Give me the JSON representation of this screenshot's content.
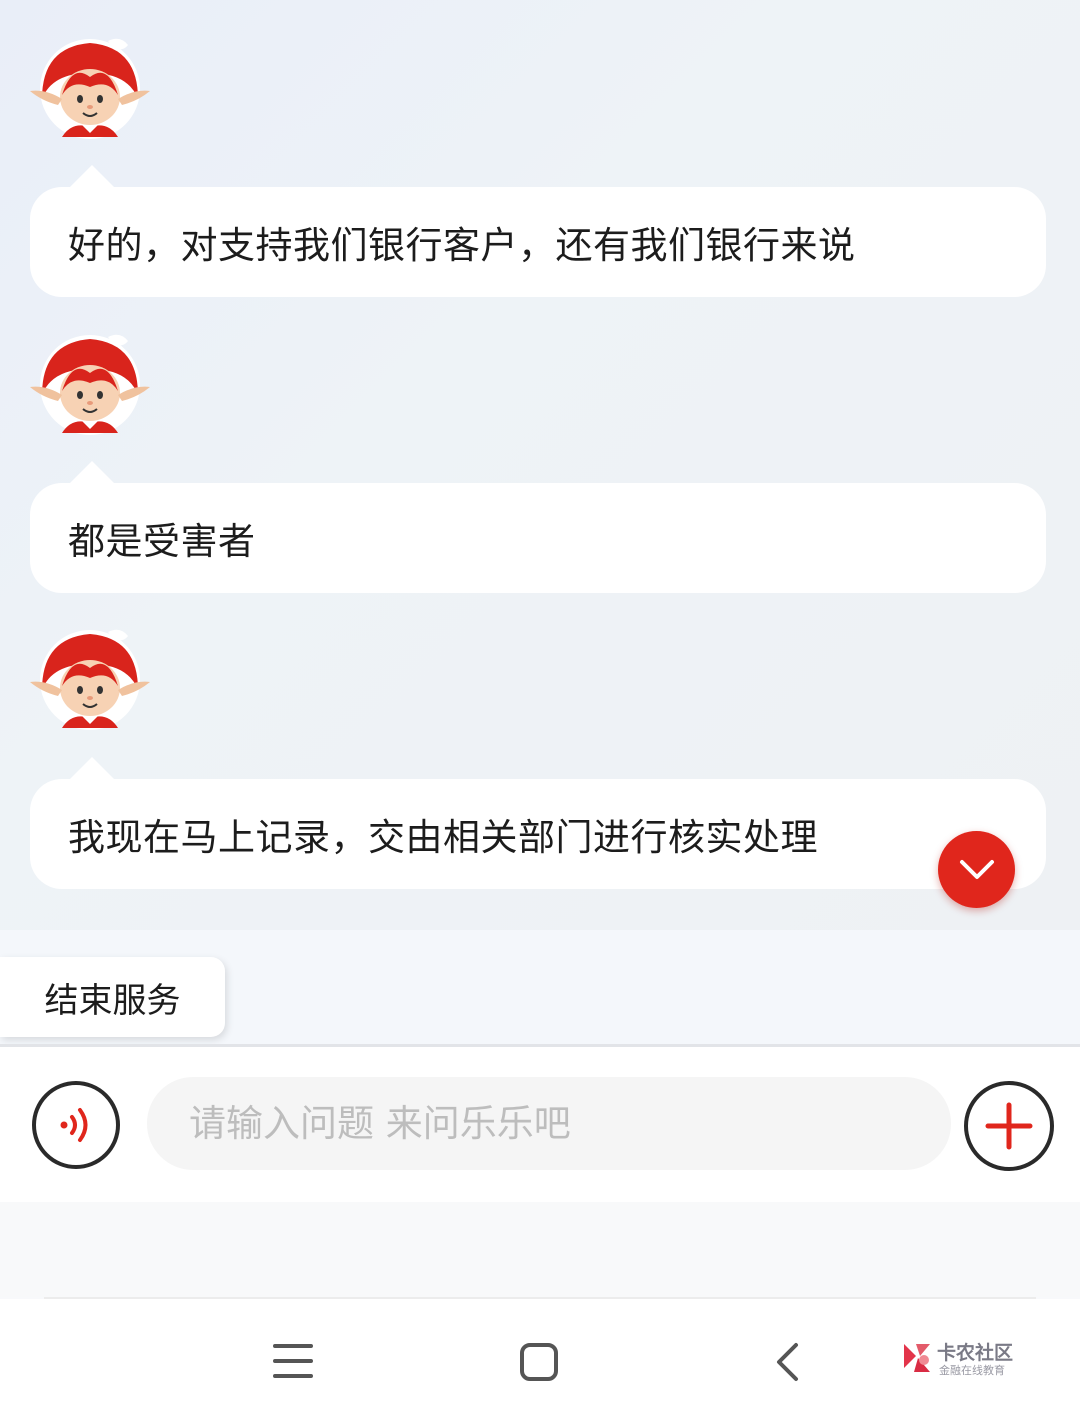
{
  "chat": {
    "messages": [
      {
        "sender": "bot",
        "text": "好的，对支持我们银行客户，还有我们银行来说"
      },
      {
        "sender": "bot",
        "text": "都是受害者"
      },
      {
        "sender": "bot",
        "text": "我现在马上记录，交由相关部门进行核实处理"
      }
    ],
    "avatar_icon": "monkey-mascot-icon",
    "scroll_button_icon": "chevron-down-icon"
  },
  "actions": {
    "end_service_label": "结束服务"
  },
  "input": {
    "placeholder": "请输入问题 来问乐乐吧",
    "value": "",
    "voice_icon": "voice-wave-icon",
    "add_icon": "plus-icon"
  },
  "nav": {
    "menu_icon": "menu-icon",
    "home_icon": "square-home-icon",
    "back_icon": "back-chevron-icon"
  },
  "watermark": {
    "title": "卡农社区",
    "subtitle": "金融在线教育"
  },
  "colors": {
    "accent_red": "#e0261c",
    "bubble_bg": "#ffffff",
    "text": "#1c1c1c"
  }
}
